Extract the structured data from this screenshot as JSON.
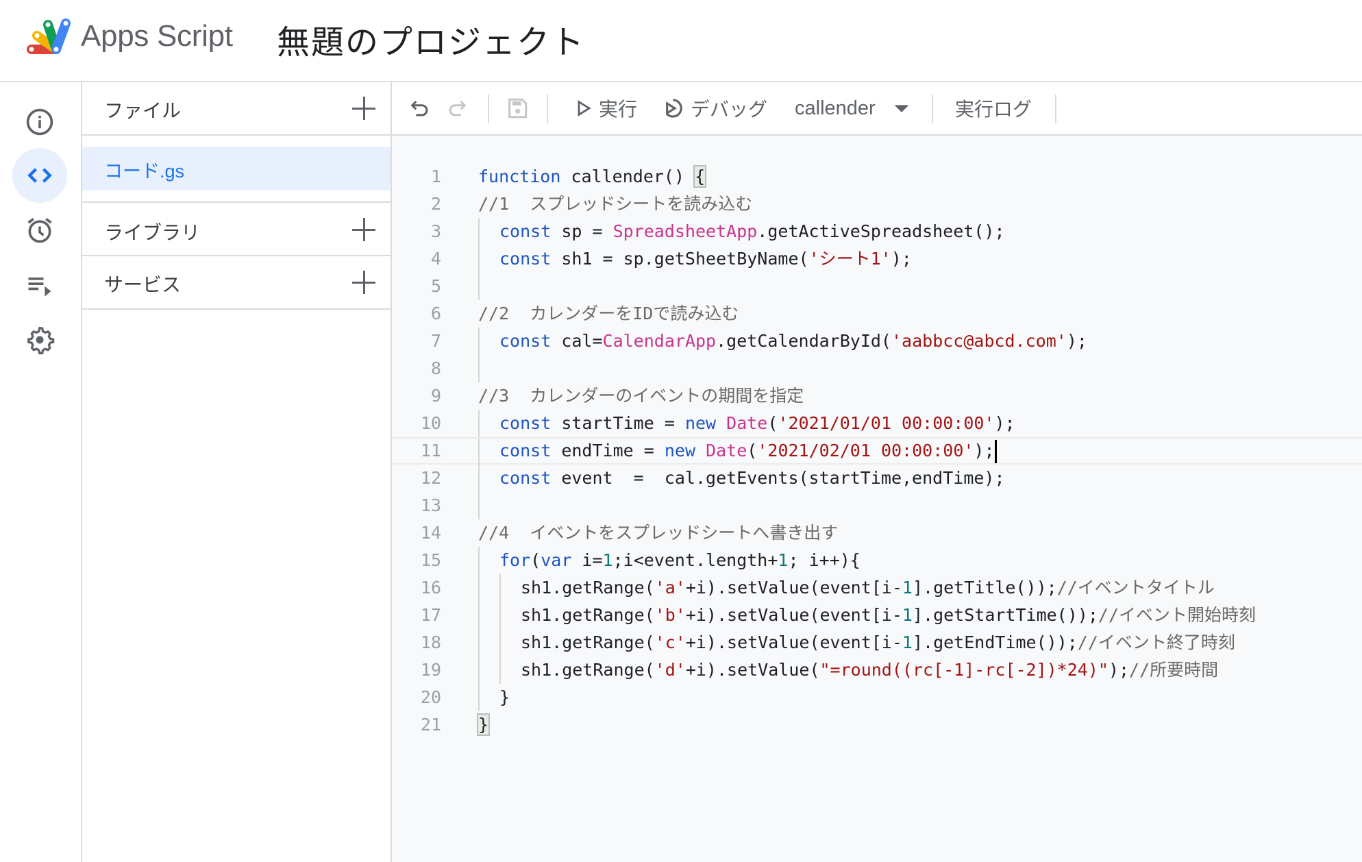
{
  "header": {
    "app_name": "Apps Script",
    "project_title": "無題のプロジェクト",
    "logo_colors": [
      "#db4437",
      "#f4b400",
      "#0f9d58",
      "#4285f4"
    ]
  },
  "rail": {
    "items": [
      {
        "name": "overview",
        "icon": "info-icon",
        "active": false
      },
      {
        "name": "editor",
        "icon": "code-icon",
        "active": true
      },
      {
        "name": "triggers",
        "icon": "alarm-clock-icon",
        "active": false
      },
      {
        "name": "executions",
        "icon": "playlist-play-icon",
        "active": false
      },
      {
        "name": "settings",
        "icon": "gear-icon",
        "active": false
      }
    ],
    "accent": "#1a73e8"
  },
  "files_panel": {
    "files_label": "ファイル",
    "files": [
      {
        "name": "コード.gs",
        "selected": true
      }
    ],
    "libraries_label": "ライブラリ",
    "services_label": "サービス"
  },
  "toolbar": {
    "undo": "undo-icon",
    "redo": "redo-icon",
    "save": "save-icon",
    "run_label": "実行",
    "debug_label": "デバッグ",
    "function_select": "callender",
    "exec_log_label": "実行ログ"
  },
  "editor": {
    "active_line": 11,
    "lines": [
      {
        "n": "1",
        "indent": 0,
        "tokens": [
          [
            "kw",
            "function"
          ],
          [
            "plain",
            " callender() "
          ],
          [
            "bracket",
            "{"
          ]
        ]
      },
      {
        "n": "2",
        "indent": 0,
        "tokens": [
          [
            "cm",
            "//1  スプレッドシートを読み込む"
          ]
        ]
      },
      {
        "n": "3",
        "indent": 1,
        "tokens": [
          [
            "kw",
            "const"
          ],
          [
            "plain",
            " sp = "
          ],
          [
            "cls",
            "SpreadsheetApp"
          ],
          [
            "plain",
            ".getActiveSpreadsheet();"
          ]
        ]
      },
      {
        "n": "4",
        "indent": 1,
        "tokens": [
          [
            "kw",
            "const"
          ],
          [
            "plain",
            " sh1 = sp.getSheetByName("
          ],
          [
            "str",
            "'シート1'"
          ],
          [
            "plain",
            ");"
          ]
        ]
      },
      {
        "n": "5",
        "indent": 1,
        "tokens": []
      },
      {
        "n": "6",
        "indent": 0,
        "tokens": [
          [
            "cm",
            "//2  カレンダーをIDで読み込む"
          ]
        ]
      },
      {
        "n": "7",
        "indent": 1,
        "tokens": [
          [
            "kw",
            "const"
          ],
          [
            "plain",
            " cal="
          ],
          [
            "cls",
            "CalendarApp"
          ],
          [
            "plain",
            ".getCalendarById("
          ],
          [
            "str",
            "'aabbcc@abcd.com'"
          ],
          [
            "plain",
            ");"
          ]
        ]
      },
      {
        "n": "8",
        "indent": 1,
        "tokens": []
      },
      {
        "n": "9",
        "indent": 0,
        "tokens": [
          [
            "cm",
            "//3  カレンダーのイベントの期間を指定"
          ]
        ]
      },
      {
        "n": "10",
        "indent": 1,
        "tokens": [
          [
            "kw",
            "const"
          ],
          [
            "plain",
            " startTime = "
          ],
          [
            "kw",
            "new"
          ],
          [
            "plain",
            " "
          ],
          [
            "cls",
            "Date"
          ],
          [
            "plain",
            "("
          ],
          [
            "str",
            "'2021/01/01 00:00:00'"
          ],
          [
            "plain",
            ");"
          ]
        ]
      },
      {
        "n": "11",
        "indent": 1,
        "tokens": [
          [
            "kw",
            "const"
          ],
          [
            "plain",
            " endTime = "
          ],
          [
            "kw",
            "new"
          ],
          [
            "plain",
            " "
          ],
          [
            "cls",
            "Date"
          ],
          [
            "plain",
            "("
          ],
          [
            "str",
            "'2021/02/01 00:00:00'"
          ],
          [
            "plain",
            ");"
          ],
          [
            "cursor",
            ""
          ]
        ]
      },
      {
        "n": "12",
        "indent": 1,
        "tokens": [
          [
            "kw",
            "const"
          ],
          [
            "plain",
            " event  =  cal.getEvents(startTime,endTime);"
          ]
        ]
      },
      {
        "n": "13",
        "indent": 1,
        "tokens": []
      },
      {
        "n": "14",
        "indent": 0,
        "tokens": [
          [
            "cm",
            "//4  イベントをスプレッドシートへ書き出す"
          ]
        ]
      },
      {
        "n": "15",
        "indent": 1,
        "tokens": [
          [
            "kw",
            "for"
          ],
          [
            "plain",
            "("
          ],
          [
            "kw",
            "var"
          ],
          [
            "plain",
            " i="
          ],
          [
            "num",
            "1"
          ],
          [
            "plain",
            ";i<event.length+"
          ],
          [
            "num",
            "1"
          ],
          [
            "plain",
            "; i++){"
          ]
        ]
      },
      {
        "n": "16",
        "indent": 2,
        "tokens": [
          [
            "plain",
            "sh1.getRange("
          ],
          [
            "str",
            "'a'"
          ],
          [
            "plain",
            "+i).setValue(event[i-"
          ],
          [
            "num",
            "1"
          ],
          [
            "plain",
            "].getTitle());"
          ],
          [
            "cm",
            "//イベントタイトル"
          ]
        ]
      },
      {
        "n": "17",
        "indent": 2,
        "tokens": [
          [
            "plain",
            "sh1.getRange("
          ],
          [
            "str",
            "'b'"
          ],
          [
            "plain",
            "+i).setValue(event[i-"
          ],
          [
            "num",
            "1"
          ],
          [
            "plain",
            "].getStartTime());"
          ],
          [
            "cm",
            "//イベント開始時刻"
          ]
        ]
      },
      {
        "n": "18",
        "indent": 2,
        "tokens": [
          [
            "plain",
            "sh1.getRange("
          ],
          [
            "str",
            "'c'"
          ],
          [
            "plain",
            "+i).setValue(event[i-"
          ],
          [
            "num",
            "1"
          ],
          [
            "plain",
            "].getEndTime());"
          ],
          [
            "cm",
            "//イベント終了時刻"
          ]
        ]
      },
      {
        "n": "19",
        "indent": 2,
        "tokens": [
          [
            "plain",
            "sh1.getRange("
          ],
          [
            "str",
            "'d'"
          ],
          [
            "plain",
            "+i).setValue("
          ],
          [
            "str",
            "\"=round((rc[-1]-rc[-2])*24)\""
          ],
          [
            "plain",
            ");"
          ],
          [
            "cm",
            "//所要時間"
          ]
        ]
      },
      {
        "n": "20",
        "indent": 1,
        "tokens": [
          [
            "plain",
            "}"
          ]
        ],
        "close": true
      },
      {
        "n": "21",
        "indent": 0,
        "tokens": [
          [
            "bracket",
            "}"
          ]
        ]
      }
    ]
  }
}
